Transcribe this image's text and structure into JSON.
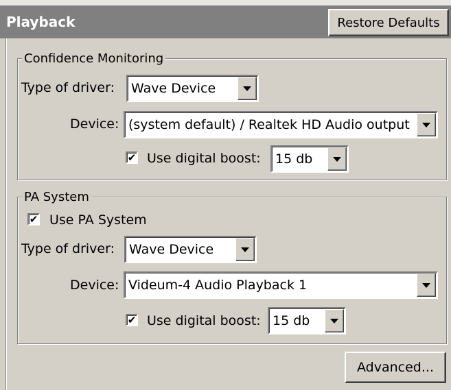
{
  "header": {
    "title": "Playback",
    "restore_defaults": "Restore Defaults"
  },
  "confidence": {
    "legend": "Confidence Monitoring",
    "driver_label": "Type of driver:",
    "driver_value": "Wave Device",
    "device_label": "Device:",
    "device_value": "(system default)  /  Realtek HD Audio output",
    "boost_checked": true,
    "boost_label": "Use digital boost:",
    "boost_value": "15 db"
  },
  "pa": {
    "legend": "PA System",
    "use_checked": true,
    "use_label": "Use PA System",
    "driver_label": "Type of driver:",
    "driver_value": "Wave Device",
    "device_label": "Device:",
    "device_value": "Videum-4 Audio Playback 1",
    "boost_checked": true,
    "boost_label": "Use digital boost:",
    "boost_value": "15 db"
  },
  "advanced": "Advanced...",
  "check_glyph": "✔"
}
